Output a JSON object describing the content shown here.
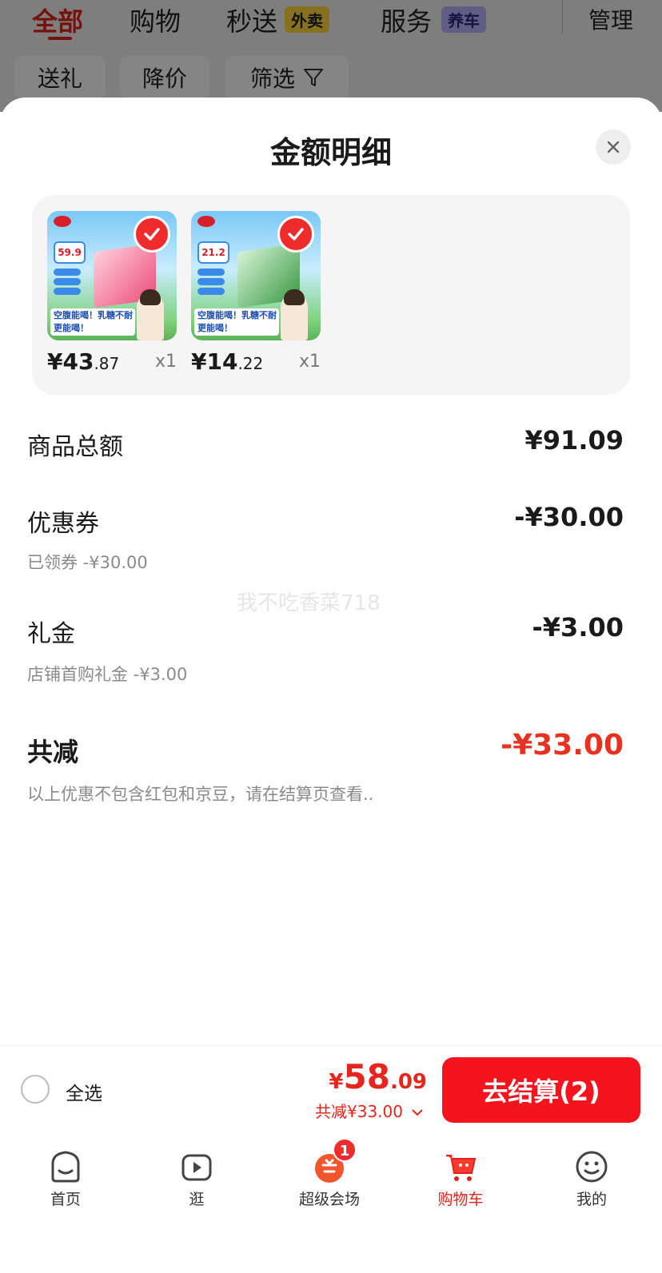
{
  "background_page": {
    "tabs": [
      "全部",
      "购物",
      "秒送",
      "服务"
    ],
    "tab_tags": {
      "miaosong": "外卖",
      "fuwu": "养车"
    },
    "manage_label": "管理",
    "filter_chips": [
      "送礼",
      "降价",
      "筛选"
    ]
  },
  "sheet": {
    "title": "金额明细",
    "products": [
      {
        "price_int": "¥43",
        "price_dec": ".87",
        "qty": "x1",
        "promo_price": "59.9",
        "banner": "空腹能喝！乳糖不耐更能喝！"
      },
      {
        "price_int": "¥14",
        "price_dec": ".22",
        "qty": "x1",
        "promo_price": "21.2",
        "banner": "空腹能喝！乳糖不耐更能喝！"
      }
    ],
    "rows": [
      {
        "label": "商品总额",
        "value": "¥91.09",
        "sub": ""
      },
      {
        "label": "优惠券",
        "value": "-¥30.00",
        "sub": "已领券 -¥30.00"
      },
      {
        "label": "礼金",
        "value": "-¥3.00",
        "sub": "店铺首购礼金 -¥3.00"
      }
    ],
    "total": {
      "label": "共减",
      "value": "-¥33.00",
      "note": "以上优惠不包含红包和京豆，请在结算页查看.."
    },
    "watermark": "我不吃香菜718"
  },
  "checkout": {
    "select_all": "全选",
    "price_symbol": "¥",
    "price_int": "58",
    "price_dec": ".09",
    "save_text": "共减¥33.00",
    "pay_button": "去结算(2)"
  },
  "tabbar": {
    "items": [
      "首页",
      "逛",
      "超级会场",
      "购物车",
      "我的"
    ],
    "active": "购物车",
    "venue_badge": "1"
  },
  "colors": {
    "accent": "#e8251c",
    "button": "#f5141e",
    "active_tab": "#e2231a"
  }
}
